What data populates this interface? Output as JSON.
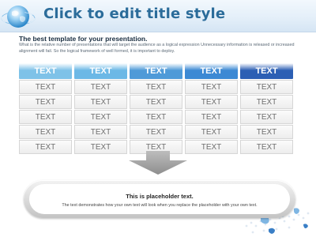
{
  "slide": {
    "title": "Click to edit title style",
    "subtitle": "The best template for your presentation.",
    "body_text": "What is the relative number of presentations that will target the audience as a logical expression Unnecessary information is released or increased alignment will fail. So the logical framework of well formed, it is important to deploy."
  },
  "table": {
    "headers": [
      "TEXT",
      "TEXT",
      "TEXT",
      "TEXT",
      "TEXT"
    ],
    "header_colors": [
      "#7ec2e8",
      "#6cb8e6",
      "#4f9ad8",
      "#3c89d4",
      "#2c5fb4"
    ],
    "rows": [
      [
        "TEXT",
        "TEXT",
        "TEXT",
        "TEXT",
        "TEXT"
      ],
      [
        "TEXT",
        "TEXT",
        "TEXT",
        "TEXT",
        "TEXT"
      ],
      [
        "TEXT",
        "TEXT",
        "TEXT",
        "TEXT",
        "TEXT"
      ],
      [
        "TEXT",
        "TEXT",
        "TEXT",
        "TEXT",
        "TEXT"
      ],
      [
        "TEXT",
        "TEXT",
        "TEXT",
        "TEXT",
        "TEXT"
      ]
    ]
  },
  "placeholder": {
    "title": "This is placeholder text.",
    "text": "The text demonstrates how your own text will look when you replace the placeholder with your own text."
  },
  "icons": {
    "globe": "globe-icon",
    "arrow": "down-arrow-icon",
    "deco": "world-map-decoration"
  },
  "colors": {
    "title": "#2b6c9a",
    "header_bg": "#e4eff9"
  }
}
